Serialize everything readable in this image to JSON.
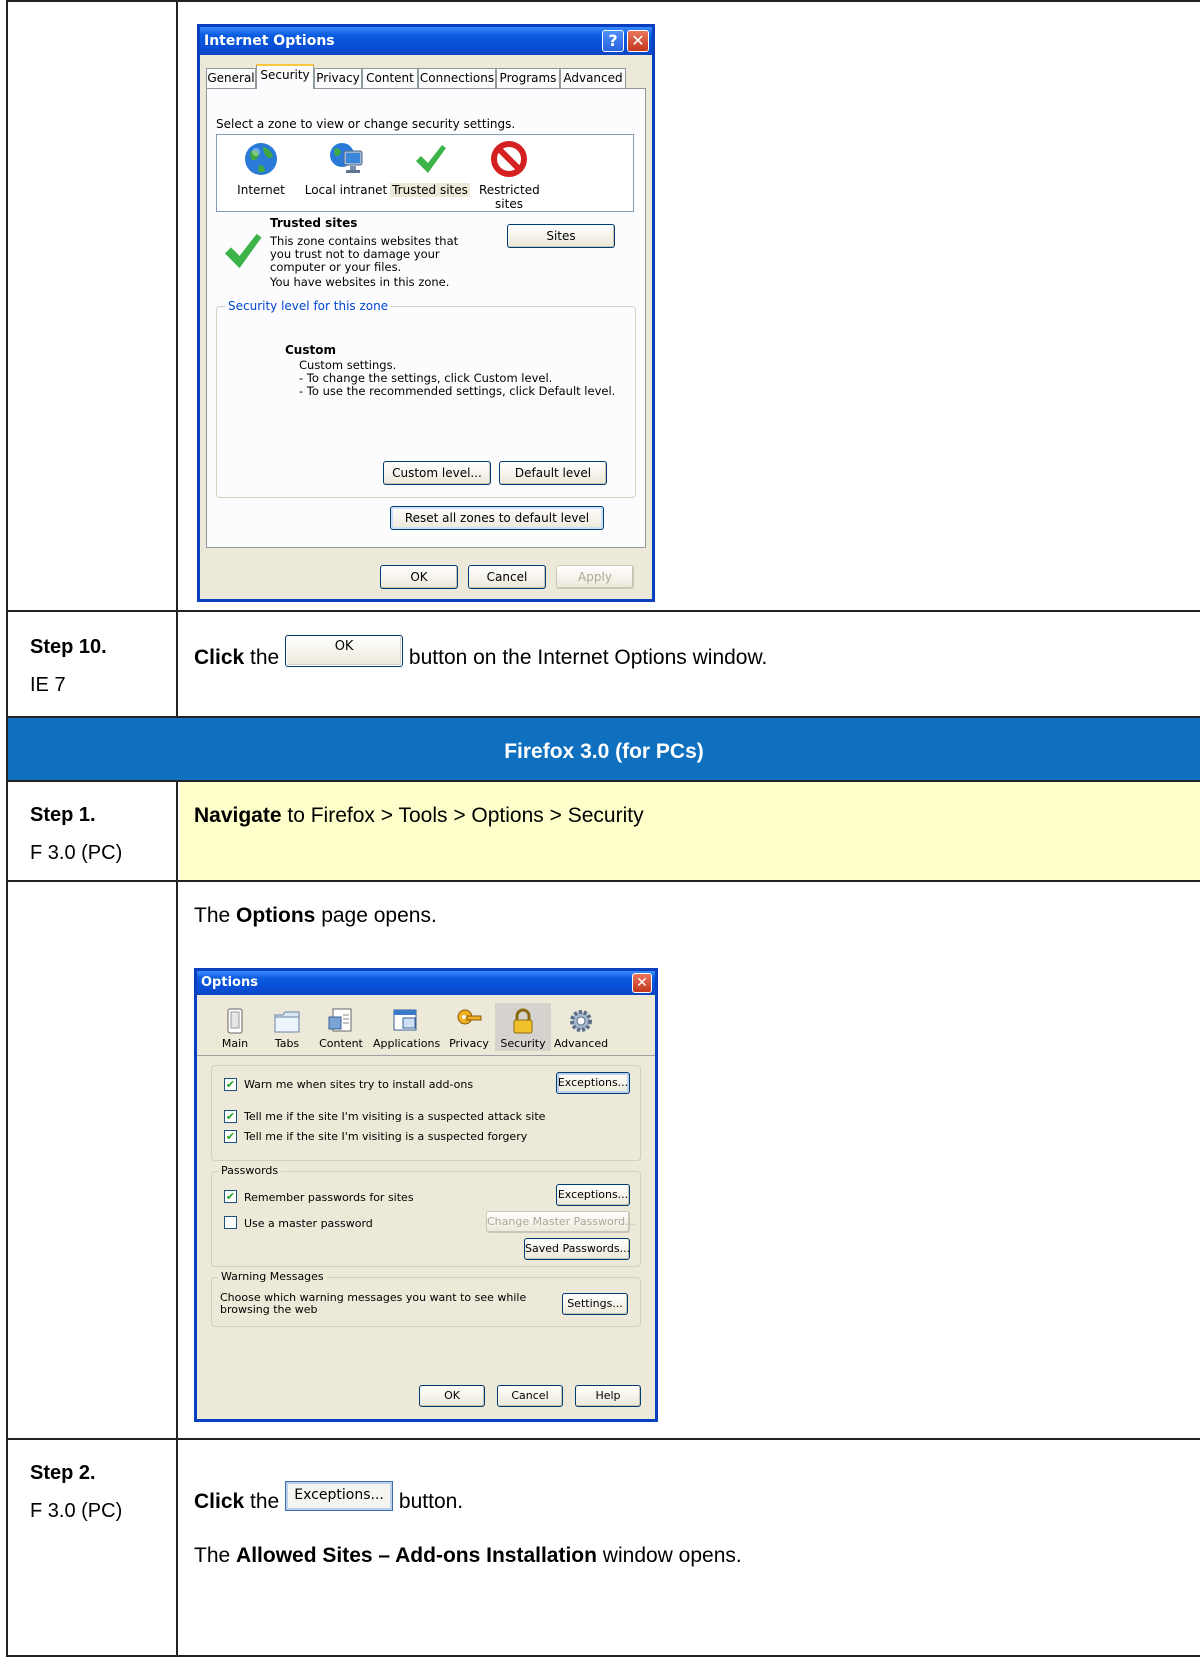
{
  "ie_dialog": {
    "title": "Internet Options",
    "tabs": [
      "General",
      "Security",
      "Privacy",
      "Content",
      "Connections",
      "Programs",
      "Advanced"
    ],
    "active_tab": "Security",
    "zone_prompt": "Select a zone to view or change security settings.",
    "zones": [
      {
        "label": "Internet",
        "icon": "globe-icon"
      },
      {
        "label": "Local intranet",
        "icon": "monitor-globe-icon"
      },
      {
        "label": "Trusted sites",
        "icon": "checkmark-icon"
      },
      {
        "label": "Restricted sites",
        "icon": "prohibited-icon"
      }
    ],
    "selected_zone_title": "Trusted sites",
    "selected_zone_desc": "This zone contains websites that you trust not to damage your computer or your files.",
    "selected_zone_note": "You have websites in this zone.",
    "sites_button": "Sites",
    "security_level_legend": "Security level for this zone",
    "custom_title": "Custom",
    "custom_line1": "Custom settings.",
    "custom_line2": "- To change the settings, click Custom level.",
    "custom_line3": "- To use the recommended settings, click Default level.",
    "custom_level_button": "Custom level...",
    "default_level_button": "Default level",
    "reset_button": "Reset all zones to default level",
    "ok_button": "OK",
    "cancel_button": "Cancel",
    "apply_button": "Apply"
  },
  "step10": {
    "step": "Step 10.",
    "browser": "IE 7",
    "verb": "Click",
    "pre": " the ",
    "button": "OK",
    "post": " button on the Internet Options window."
  },
  "firefox_header": "Firefox 3.0 (for PCs)",
  "step1": {
    "step": "Step 1.",
    "browser": "F 3.0 (PC)",
    "verb": "Navigate",
    "text": " to Firefox > Tools > Options > Security"
  },
  "options_opens": {
    "pre": "The ",
    "bold": "Options",
    "post": " page opens."
  },
  "fx_dialog": {
    "title": "Options",
    "toolbar": [
      {
        "label": "Main",
        "icon": "main-switch-icon"
      },
      {
        "label": "Tabs",
        "icon": "tabs-folder-icon"
      },
      {
        "label": "Content",
        "icon": "content-page-icon"
      },
      {
        "label": "Applications",
        "icon": "applications-window-icon"
      },
      {
        "label": "Privacy",
        "icon": "privacy-key-icon"
      },
      {
        "label": "Security",
        "icon": "padlock-icon"
      },
      {
        "label": "Advanced",
        "icon": "gear-icon"
      }
    ],
    "active_pane": "Security",
    "warn_addons": "Warn me when sites try to install add-ons",
    "exceptions_button": "Exceptions...",
    "attack_site": "Tell me if the site I'm visiting is a suspected attack site",
    "forgery": "Tell me if the site I'm visiting is a suspected forgery",
    "passwords_legend": "Passwords",
    "remember_passwords": "Remember passwords for sites",
    "master_password": "Use a master password",
    "change_master_button": "Change Master Password...",
    "saved_passwords_button": "Saved Passwords...",
    "warning_legend": "Warning Messages",
    "warning_text": "Choose which warning messages you want to see while browsing the web",
    "settings_button": "Settings...",
    "ok_button": "OK",
    "cancel_button": "Cancel",
    "help_button": "Help"
  },
  "step2": {
    "step": "Step 2.",
    "browser": "F 3.0 (PC)",
    "verb": "Click",
    "pre": " the ",
    "button": "Exceptions...",
    "post": " button.",
    "result_pre": "The ",
    "result_bold": "Allowed Sites – Add-ons Installation",
    "result_post": " window opens."
  }
}
